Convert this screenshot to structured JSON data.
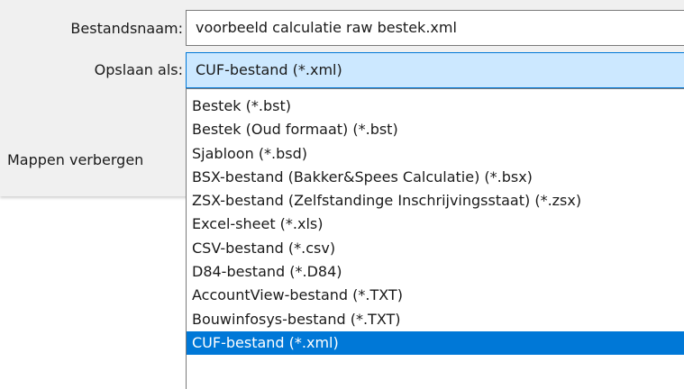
{
  "form": {
    "filename_label": "Bestandsnaam:",
    "filename_value": "voorbeeld calculatie raw bestek.xml",
    "saveas_label": "Opslaan als:",
    "saveas_selected": "CUF-bestand (*.xml)",
    "hide_folders_label": "Mappen verbergen"
  },
  "dropdown": {
    "options": [
      "Bestek (*.bst)",
      "Bestek (Oud formaat) (*.bst)",
      "Sjabloon (*.bsd)",
      "BSX-bestand (Bakker&Spees Calculatie) (*.bsx)",
      "ZSX-bestand (Zelfstandinge Inschrijvingsstaat) (*.zsx)",
      "Excel-sheet (*.xls)",
      "CSV-bestand (*.csv)",
      "D84-bestand (*.D84)",
      "AccountView-bestand (*.TXT)",
      "Bouwinfosys-bestand (*.TXT)",
      "CUF-bestand (*.xml)"
    ],
    "selected_index": 10
  },
  "colors": {
    "selection_blue": "#0078d7",
    "focus_fill": "#cce8ff",
    "panel_gray": "#f0f0f0"
  }
}
